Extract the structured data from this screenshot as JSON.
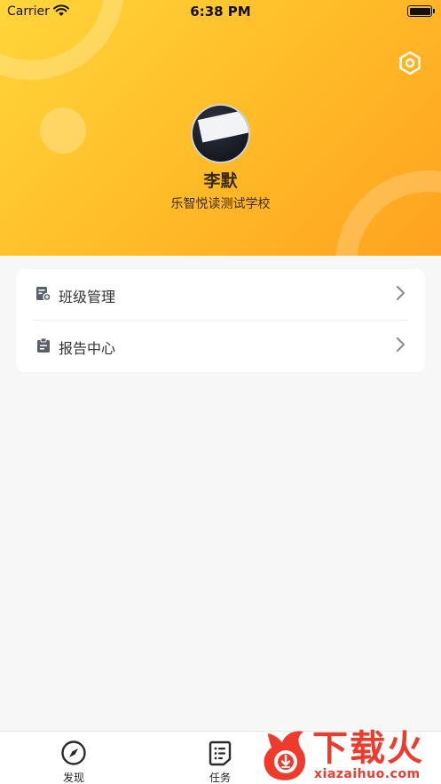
{
  "status_bar": {
    "carrier": "Carrier",
    "time": "6:38 PM"
  },
  "profile": {
    "name": "李默",
    "school": "乐智悦读测试学校"
  },
  "menu": {
    "items": [
      {
        "label": "班级管理",
        "icon": "class-management-icon"
      },
      {
        "label": "报告中心",
        "icon": "clipboard-report-icon"
      }
    ]
  },
  "tabbar": {
    "tabs": [
      {
        "label": "发现",
        "icon": "compass-icon"
      },
      {
        "label": "任务",
        "icon": "task-list-icon"
      }
    ]
  },
  "watermark": {
    "title": "下载火",
    "site": "xiazaihuo.com"
  },
  "colors": {
    "header_start": "#ffd63a",
    "header_end": "#ffa21f",
    "watermark_red": "#ef3b2c",
    "text_dark": "#333333"
  }
}
